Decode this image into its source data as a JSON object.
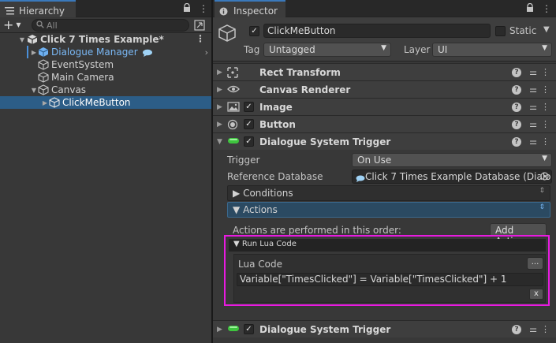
{
  "hierarchy": {
    "tab_label": "Hierarchy",
    "search_placeholder": "All",
    "scene": {
      "name": "Click 7 Times Example*"
    },
    "items": [
      {
        "label": "Dialogue Manager"
      },
      {
        "label": "EventSystem"
      },
      {
        "label": "Main Camera"
      },
      {
        "label": "Canvas"
      },
      {
        "label": "ClickMeButton"
      }
    ]
  },
  "inspector": {
    "tab_label": "Inspector",
    "object_name": "ClickMeButton",
    "static_label": "Static",
    "tag_label": "Tag",
    "tag_value": "Untagged",
    "layer_label": "Layer",
    "layer_value": "UI",
    "components": [
      {
        "name": "Rect Transform"
      },
      {
        "name": "Canvas Renderer"
      },
      {
        "name": "Image"
      },
      {
        "name": "Button"
      },
      {
        "name": "Dialogue System Trigger"
      },
      {
        "name": "Dialogue System Trigger"
      }
    ],
    "trigger": {
      "trigger_label": "Trigger",
      "trigger_value": "On Use",
      "db_label": "Reference Database",
      "db_value": "Click 7 Times Example Database (Dialog",
      "conditions_label": "Conditions",
      "actions_label": "Actions",
      "actions_text": "Actions are performed in this order:",
      "add_action_label": "Add Action",
      "run_lua_label": "Run Lua Code",
      "lua_code_label": "Lua Code",
      "ellipsis_label": "...",
      "lua_code_value": "Variable[\"TimesClicked\"] = Variable[\"TimesClicked\"] + 1",
      "remove_label": "x"
    }
  },
  "colors": {
    "selection": "#2c5d87",
    "highlight": "#e81be0",
    "prefab_text": "#7ab8f5",
    "accent": "#3a79bb"
  }
}
